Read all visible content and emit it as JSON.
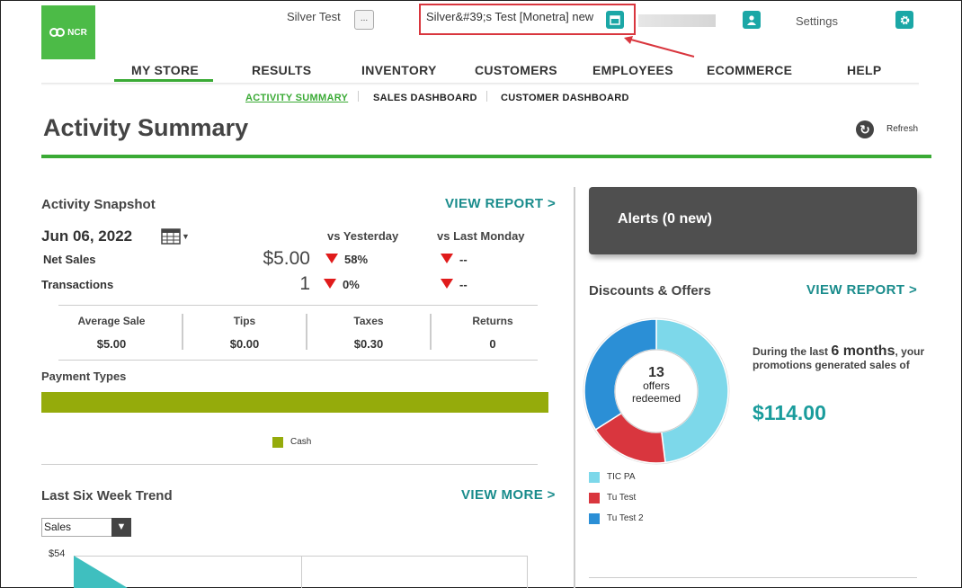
{
  "header": {
    "logo_text": "NCR",
    "store_name": "Silver Test",
    "store_more_label": "...",
    "location_name": "Silver&#39;s Test [Monetra] new",
    "settings_label": "Settings"
  },
  "nav": {
    "items": [
      "MY STORE",
      "RESULTS",
      "INVENTORY",
      "CUSTOMERS",
      "EMPLOYEES",
      "ECOMMERCE",
      "HELP"
    ],
    "active": "MY STORE",
    "sub_items": [
      "ACTIVITY SUMMARY",
      "SALES DASHBOARD",
      "CUSTOMER DASHBOARD"
    ],
    "active_sub": "ACTIVITY SUMMARY"
  },
  "page": {
    "title": "Activity Summary",
    "refresh_label": "Refresh"
  },
  "snapshot": {
    "heading": "Activity Snapshot",
    "view_report_label": "VIEW REPORT >",
    "date": "Jun 06, 2022",
    "col_yesterday": "vs Yesterday",
    "col_last_monday": "vs Last Monday",
    "rows": [
      {
        "label": "Net Sales",
        "value": "$5.00",
        "vs_yesterday": "58%",
        "vs_last_monday": "--"
      },
      {
        "label": "Transactions",
        "value": "1",
        "vs_yesterday": "0%",
        "vs_last_monday": "--"
      }
    ],
    "stats": [
      {
        "label": "Average Sale",
        "value": "$5.00"
      },
      {
        "label": "Tips",
        "value": "$0.00"
      },
      {
        "label": "Taxes",
        "value": "$0.30"
      },
      {
        "label": "Returns",
        "value": "0"
      }
    ]
  },
  "payment_types": {
    "heading": "Payment Types",
    "legend": [
      {
        "label": "Cash",
        "color": "#95ab0b"
      }
    ]
  },
  "trend": {
    "heading": "Last Six Week Trend",
    "view_more_label": "VIEW MORE >",
    "select_value": "Sales",
    "y_top_label": "$54"
  },
  "alerts": {
    "text": "Alerts (0 new)"
  },
  "discounts": {
    "heading": "Discounts & Offers",
    "view_report_label": "VIEW REPORT >",
    "offers_count": "13",
    "offers_label_1": "offers",
    "offers_label_2": "redeemed",
    "promo_prefix": "During the last",
    "promo_period": "6 months",
    "promo_suffix": ", your promotions generated sales of",
    "promo_amount": "$114.00",
    "legend": [
      {
        "label": "TIC PA",
        "color": "#7dd8ea"
      },
      {
        "label": "Tu Test",
        "color": "#d9363e"
      },
      {
        "label": "Tu Test 2",
        "color": "#2b8fd6"
      }
    ]
  },
  "chart_data": [
    {
      "type": "pie",
      "labels": [
        "TIC PA",
        "Tu Test",
        "Tu Test 2"
      ],
      "values": [
        48,
        18,
        34
      ],
      "colors": [
        "#7dd8ea",
        "#d9363e",
        "#2b8fd6"
      ]
    }
  ]
}
